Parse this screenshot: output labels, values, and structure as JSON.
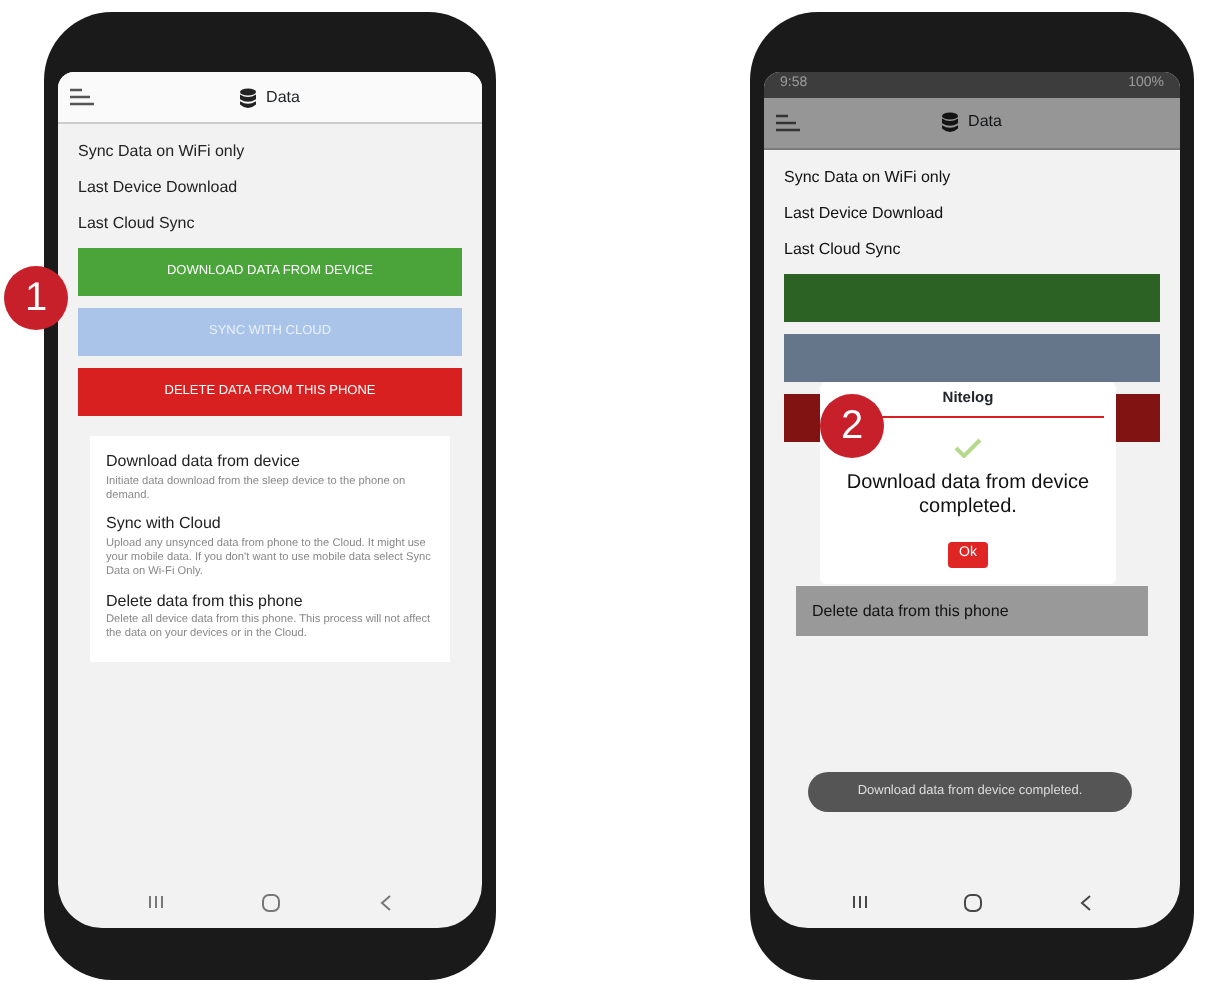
{
  "phones": [
    {
      "dimmed": false,
      "header": {
        "title": "Data"
      },
      "settings": [
        "Sync Data on WiFi only",
        "Last Device Download",
        "Last Cloud Sync"
      ],
      "buttons": [
        {
          "kind": "download",
          "label": "DOWNLOAD DATA FROM DEVICE"
        },
        {
          "kind": "sync",
          "label": "SYNC WITH CLOUD"
        },
        {
          "kind": "delete",
          "label": "DELETE DATA FROM THIS PHONE"
        }
      ],
      "info": [
        {
          "heading": "Download data from device",
          "text": "Initiate data download from the sleep device to the phone on demand."
        },
        {
          "heading": "Sync with Cloud",
          "text": "Upload any unsynced data from phone to the Cloud. It might use your mobile data. If you don't want to use mobile data select Sync Data on Wi-Fi Only."
        },
        {
          "heading": "Delete data from this phone",
          "text": "Delete all device data from this phone. This process will not affect the data on your devices or in the Cloud."
        }
      ]
    },
    {
      "dimmed": true,
      "status_bar": {
        "time": "9:58",
        "battery": "100%"
      },
      "header": {
        "title": "Data"
      },
      "settings": [
        "Sync Data on WiFi only",
        "Last Device Download",
        "Last Cloud Sync"
      ],
      "buttons": [
        {
          "kind": "download"
        },
        {
          "kind": "sync"
        },
        {
          "kind": "delete"
        }
      ],
      "info": [
        {
          "heading": "Delete data from this phone"
        }
      ],
      "dialog": {
        "title": "Nitelog",
        "message": "Download data from device completed.",
        "button": "Ok"
      },
      "toast": "Download data from device completed."
    }
  ],
  "callouts": [
    "1",
    "2"
  ]
}
